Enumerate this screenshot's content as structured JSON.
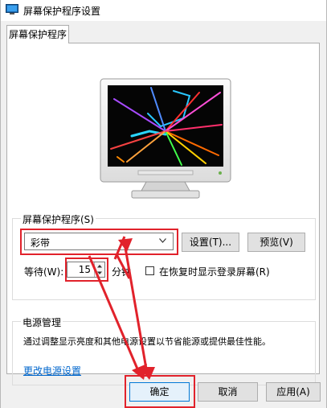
{
  "window": {
    "title": "屏幕保护程序设置"
  },
  "tab": {
    "label": "屏幕保护程序"
  },
  "screensaver": {
    "group_label": "屏幕保护程序(S)",
    "selected": "彩带",
    "settings_label": "设置(T)...",
    "preview_label": "预览(V)",
    "wait_label": "等待(W):",
    "wait_value": "15",
    "wait_unit": "分钟",
    "resume_label": "在恢复时显示登录屏幕(R)"
  },
  "power": {
    "group_label": "电源管理",
    "description": "通过调整显示亮度和其他电源设置以节省能源或提供最佳性能。",
    "link": "更改电源设置"
  },
  "footer": {
    "ok": "确定",
    "cancel": "取消",
    "apply": "应用(A)"
  },
  "colors": {
    "highlight": "#e1222b",
    "link": "#0066cc"
  }
}
